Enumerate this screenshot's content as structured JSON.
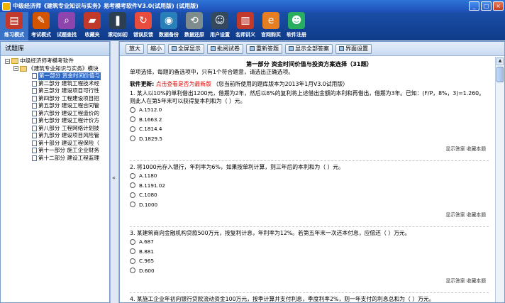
{
  "window": {
    "title": "中级经济师《建筑专业知识与实务》易考模考软件V3.0(试用版) (试用版)",
    "buttons": [
      "_",
      "□",
      "×"
    ]
  },
  "toolbar": {
    "items": [
      {
        "label": "练习模式",
        "icon": "books-icon",
        "color": "#c0392b"
      },
      {
        "label": "考试模式",
        "icon": "pencil-icon",
        "color": "#d35400"
      },
      {
        "label": "试题查找",
        "icon": "magnifier-icon",
        "color": "#8e44ad"
      },
      {
        "label": "收藏夹",
        "icon": "folder-icon",
        "color": "#c0392b"
      },
      {
        "label": "滚动如初",
        "icon": "scroll-icon",
        "color": "#2c3e50"
      },
      {
        "label": "错误反馈",
        "icon": "refresh-icon",
        "color": "#e74c3c"
      },
      {
        "label": "数据备份",
        "icon": "globe-icon",
        "color": "#2980b9"
      },
      {
        "label": "数据还原",
        "icon": "restore-icon",
        "color": "#7f8c8d"
      },
      {
        "label": "用户设置",
        "icon": "user-settings-icon",
        "color": "#34495e"
      },
      {
        "label": "名师讲义",
        "icon": "book-icon",
        "color": "#c0392b"
      },
      {
        "label": "官网购买",
        "icon": "ie-icon",
        "color": "#e67e22"
      },
      {
        "label": "软件注册",
        "icon": "user-icon",
        "color": "#27ae60"
      }
    ]
  },
  "left": {
    "header": "试题库",
    "root": "中级经济师考模考软件",
    "book": "《建筑专业知识与实务》模块",
    "parts": [
      "第一部分 资金时间价值与",
      "第二部分 建筑工程技术经",
      "第三部分 建设项目可行性",
      "第四部分 工程建设项目招",
      "第五部分 建设工程合同管",
      "第六部分 建设工程造价的",
      "第七部分 建设工程计价方",
      "第八部分 工程网络计划技",
      "第九部分 建设项目风险管",
      "第十部分 建设工程保险（",
      "第十一部分 施工企业财务",
      "第十二部分 建设工程监理"
    ]
  },
  "subbar": {
    "buttons": [
      "放大",
      "缩小",
      "全屏显示",
      "批阅试卷",
      "重新答题",
      "显示全部答案",
      "界面设置"
    ]
  },
  "content": {
    "part_title": "第一部分 资金时间价值与投资方案选择（31题）",
    "instruction": "单项选择，每题的备选项中，只有1个符合题意，请选出正确选项。",
    "update_label": "软件更新:",
    "update_link": "点击查看是否为最新版",
    "update_note": "（您当前所使用的题库版本为2013年1月V3.0试用版）",
    "show_answer": "显示答案",
    "collect": "收藏本题",
    "questions": [
      {
        "text": "1. 某人以10%的单利借出1200元，借期为2年，然后以8%的复利将上述借出金额的本利和再借出，借期为3年。已知：(F/P，8%，3)=1.260。则此人在第5年末可以获得复本利和为（ ）元。",
        "options": [
          "A.1512.0",
          "B.1663.2",
          "C.1814.4",
          "D.1829.5"
        ]
      },
      {
        "text": "2. 将1000元存入银行，年利率为6%，如果按单利计算，则三年后的本利和为（ ）元。",
        "options": [
          "A.1180",
          "B.1191.02",
          "C.1080",
          "D.1000"
        ]
      },
      {
        "text": "3. 某建筑商向金融机构贷款500万元，按复利计息，年利率为12%。若第五年末一次还本付息，应偿还（ ）万元。",
        "options": [
          "A.687",
          "B.881",
          "C.965",
          "D.600"
        ]
      },
      {
        "text": "4. 某施工企业年初向银行贷款流动资金100万元，按季计算并支付利息，季度利率2%，则一年支付的利息总和为（ ）万元。",
        "options": [
          "A.8.00"
        ]
      }
    ]
  }
}
